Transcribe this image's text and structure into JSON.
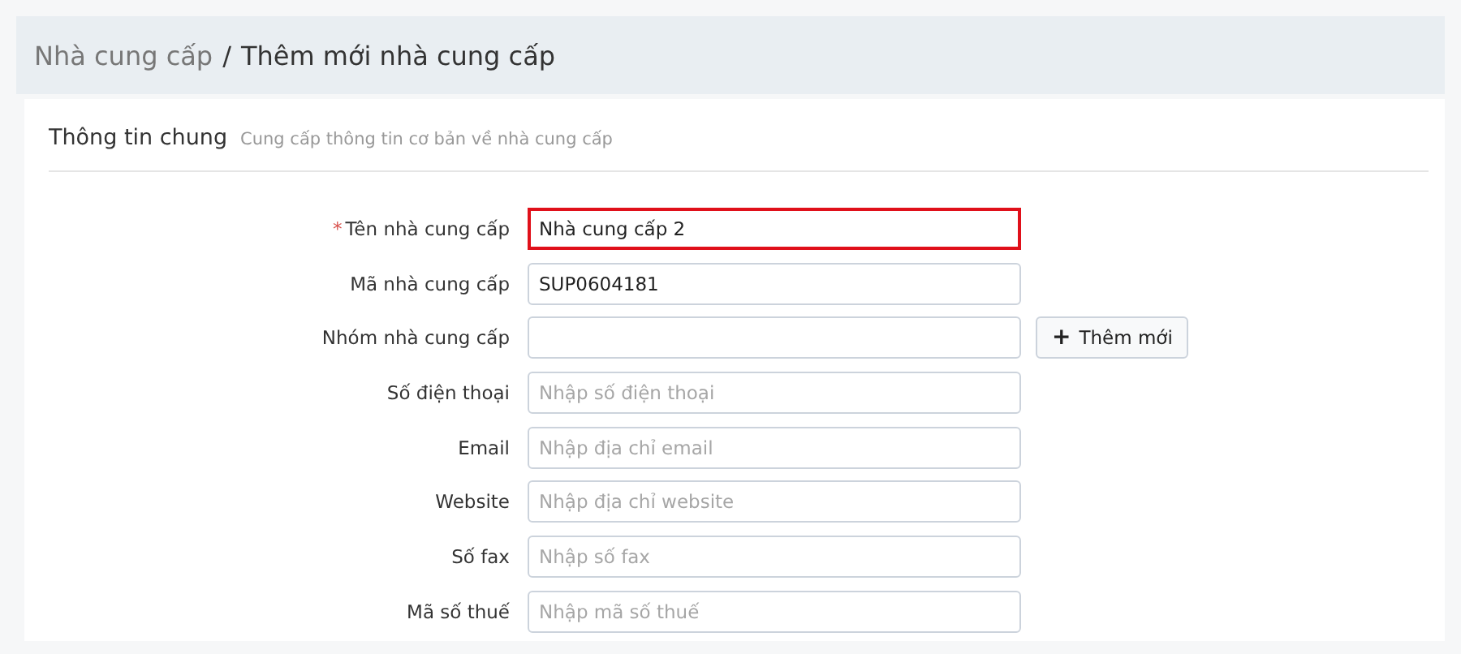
{
  "breadcrumb": {
    "parent": "Nhà cung cấp",
    "separator": "/",
    "current": "Thêm mới nhà cung cấp"
  },
  "section": {
    "title": "Thông tin chung",
    "subtitle": "Cung cấp thông tin cơ bản về nhà cung cấp"
  },
  "fields": [
    {
      "label": "Tên nhà cung cấp",
      "required_mark": "*",
      "invalid": true,
      "value": "Nhà cung cấp 2"
    },
    {
      "label": "Mã nhà cung cấp",
      "invalid": false,
      "value": "SUP0604181"
    },
    {
      "label": "Nhóm nhà cung cấp",
      "invalid": false,
      "action": {
        "icon": "+",
        "label": "Thêm mới"
      }
    },
    {
      "label": "Số điện thoại",
      "invalid": false,
      "placeholder": "Nhập số điện thoại"
    },
    {
      "label": "Email",
      "invalid": false,
      "placeholder": "Nhập địa chỉ email"
    },
    {
      "label": "Website",
      "invalid": false,
      "placeholder": "Nhập địa chỉ website"
    },
    {
      "label": "Số fax",
      "invalid": false,
      "placeholder": "Nhập số fax"
    },
    {
      "label": "Mã số thuế",
      "invalid": false,
      "placeholder": "Nhập mã số thuế"
    }
  ]
}
